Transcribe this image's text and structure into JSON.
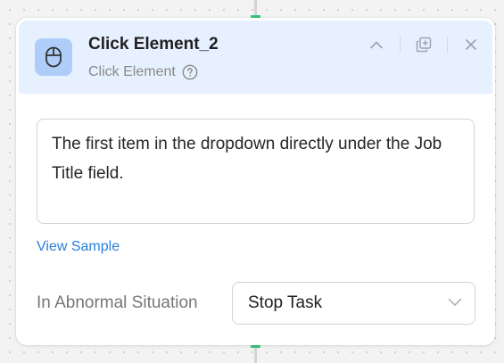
{
  "node": {
    "title": "Click Element_2",
    "type_label": "Click Element",
    "type_icon": "mouse-icon",
    "actions": [
      "collapse-icon",
      "duplicate-icon",
      "close-icon"
    ]
  },
  "description": {
    "text": "The first item in the dropdown directly under the Job Title field."
  },
  "view_sample_label": "View Sample",
  "abnormal": {
    "label": "In Abnormal Situation",
    "selected": "Stop Task"
  },
  "colors": {
    "header_bg": "#e7f0fe",
    "icon_bg": "#aecdf8",
    "link": "#2a7fd9",
    "connector_accent": "#35c57a"
  }
}
